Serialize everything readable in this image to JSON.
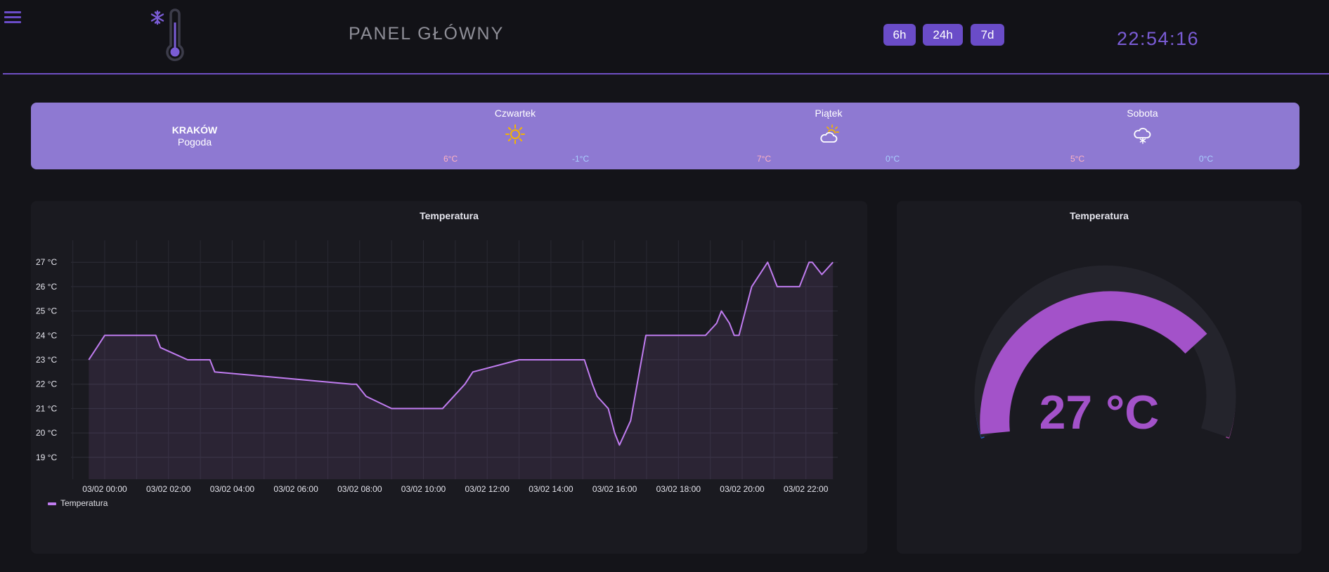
{
  "header": {
    "title": "PANEL GŁÓWNY",
    "ranges": [
      "6h",
      "24h",
      "7d"
    ],
    "clock": "22:54:16",
    "accent": "#6a4cc8",
    "icons": {
      "menu": "menu-icon",
      "logo": "thermometer-snowflake-icon"
    }
  },
  "weather": {
    "city": "KRAKÓW",
    "subtitle": "Pogoda",
    "background": "#8e79d2",
    "days": [
      {
        "name": "Czwartek",
        "icon": "sun-icon",
        "max": "6°C",
        "min": "-1°C"
      },
      {
        "name": "Piątek",
        "icon": "partly-cloudy-icon",
        "max": "7°C",
        "min": "0°C"
      },
      {
        "name": "Sobota",
        "icon": "cloud-snow-icon",
        "max": "5°C",
        "min": "0°C"
      }
    ]
  },
  "chart_panel": {
    "title": "Temperatura",
    "legend": "Temperatura"
  },
  "chart_data": {
    "type": "line",
    "title": "Temperatura",
    "series": [
      {
        "name": "Temperatura",
        "color": "#c07cf0",
        "x_hours": [
          -0.5,
          -0.25,
          0,
          0.85,
          1.0,
          1.6,
          1.75,
          2.6,
          3.3,
          3.45,
          7.75,
          7.9,
          8.2,
          9.0,
          9.4,
          9.6,
          10.6,
          11.3,
          11.55,
          13.0,
          15.05,
          15.3,
          15.45,
          15.8,
          16.0,
          16.15,
          16.5,
          16.98,
          17.1,
          18.85,
          19.2,
          19.35,
          19.6,
          19.75,
          19.9,
          20.3,
          20.8,
          21.1,
          21.8,
          22.1,
          22.2,
          22.5,
          22.85
        ],
        "values": [
          23,
          23.5,
          24,
          24,
          24,
          24,
          23.5,
          23,
          23,
          22.5,
          22,
          22,
          21.5,
          21,
          21,
          21,
          21,
          22,
          22.5,
          23,
          23,
          22,
          21.5,
          21,
          20,
          19.5,
          20.5,
          24,
          24,
          24,
          24.5,
          25,
          24.5,
          24,
          24,
          26,
          27,
          26,
          26,
          27,
          27,
          26.5,
          27
        ]
      }
    ],
    "x_tick_labels": [
      "03/02 00:00",
      "03/02 02:00",
      "03/02 04:00",
      "03/02 06:00",
      "03/02 08:00",
      "03/02 10:00",
      "03/02 12:00",
      "03/02 14:00",
      "03/02 16:00",
      "03/02 18:00",
      "03/02 20:00",
      "03/02 22:00"
    ],
    "y_tick_labels": [
      "19 °C",
      "20 °C",
      "21 °C",
      "22 °C",
      "23 °C",
      "24 °C",
      "25 °C",
      "26 °C",
      "27 °C"
    ],
    "ylim": [
      18.1,
      27.9
    ],
    "grid": true,
    "legend": "bottom-left"
  },
  "gauge": {
    "title": "Temperatura",
    "value": 27,
    "display": "27 °C",
    "color": "#a352c9"
  }
}
